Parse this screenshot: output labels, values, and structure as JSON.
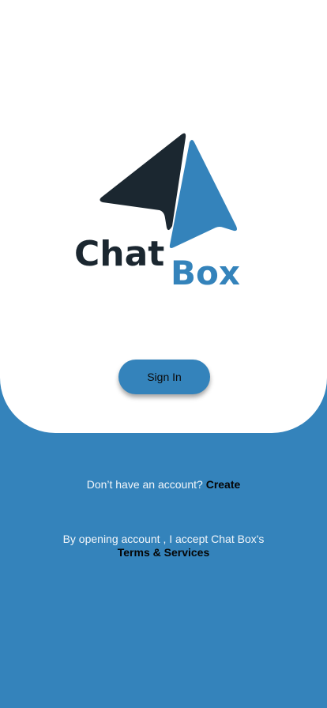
{
  "colors": {
    "background": "#3483bb",
    "panel": "#ffffff",
    "logo_dark": "#1b2730",
    "logo_blue": "#3483bb"
  },
  "logo": {
    "word_dark": "Chat",
    "word_blue": "Box"
  },
  "signin": {
    "label": "Sign In"
  },
  "account": {
    "prompt": "Don’t have an account? ",
    "create_label": "Create"
  },
  "terms": {
    "text": "By opening account , I accept Chat Box's",
    "link_label": "Terms & Services"
  }
}
